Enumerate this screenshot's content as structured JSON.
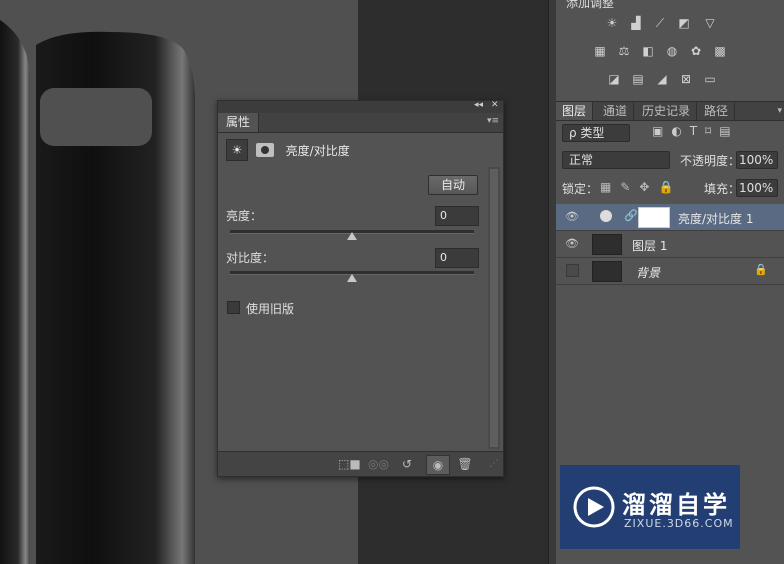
{
  "adjustments_panel": {
    "title_partial": "添加调整"
  },
  "properties_panel": {
    "tab_label": "属性",
    "adjustment_name": "亮度/对比度",
    "auto_button": "自动",
    "brightness_label": "亮度：",
    "brightness_value": "0",
    "contrast_label": "对比度：",
    "contrast_value": "0",
    "legacy_checkbox_label": "使用旧版",
    "legacy_checked": false
  },
  "layers_panel": {
    "tabs": [
      "图层",
      "通道",
      "历史记录",
      "路径"
    ],
    "active_tab": "图层",
    "filter_label": "ρ 类型",
    "blend_mode": "正常",
    "opacity_label": "不透明度：",
    "opacity_value": "100%",
    "lock_label": "锁定：",
    "fill_label": "填充：",
    "fill_value": "100%",
    "layers": [
      {
        "name": "亮度/对比度 1",
        "visible": true,
        "selected": true,
        "type": "adjustment"
      },
      {
        "name": "图层 1",
        "visible": true,
        "selected": false,
        "type": "pixel"
      },
      {
        "name": "背景",
        "visible": false,
        "selected": false,
        "type": "background",
        "locked": true
      }
    ]
  },
  "watermark": {
    "brand": "溜溜自学",
    "url": "ZIXUE.3D66.COM"
  },
  "colors": {
    "panel_bg": "#535353",
    "selected_layer": "#5a6a82",
    "watermark_bg": "#233e72"
  }
}
